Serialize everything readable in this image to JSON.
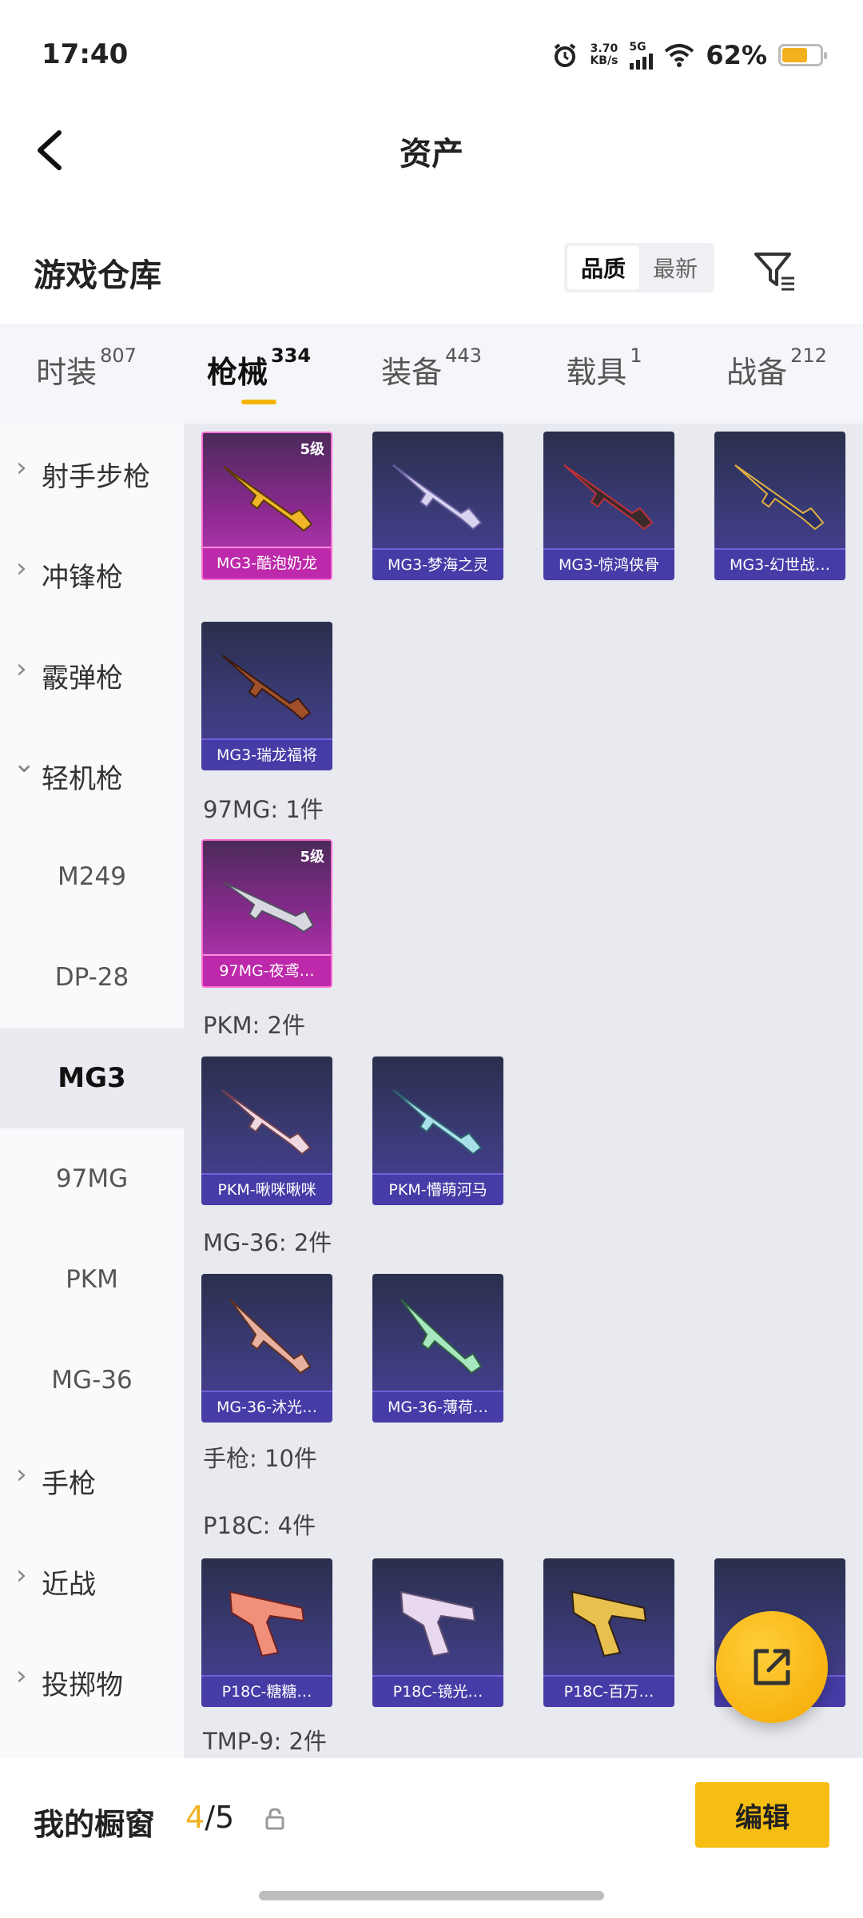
{
  "status": {
    "time": "17:40",
    "net_speed_value": "3.70",
    "net_speed_unit": "KB/s",
    "signal": "5G",
    "battery": "62%",
    "battery_level": 0.62
  },
  "header": {
    "title": "资产"
  },
  "warehouse": {
    "label": "游戏仓库",
    "sort_options": [
      "品质",
      "最新"
    ]
  },
  "tabs": [
    {
      "label": "时装",
      "count": "807"
    },
    {
      "label": "枪械",
      "count": "334"
    },
    {
      "label": "装备",
      "count": "443"
    },
    {
      "label": "载具",
      "count": "1"
    },
    {
      "label": "战备",
      "count": "212"
    }
  ],
  "sidebar": {
    "items": [
      {
        "label": "射手步枪"
      },
      {
        "label": "冲锋枪"
      },
      {
        "label": "霰弹枪"
      },
      {
        "label": "轻机枪"
      },
      {
        "label": "M249"
      },
      {
        "label": "DP-28"
      },
      {
        "label": "MG3"
      },
      {
        "label": "97MG"
      },
      {
        "label": "PKM"
      },
      {
        "label": "MG-36"
      },
      {
        "label": "手枪"
      },
      {
        "label": "近战"
      },
      {
        "label": "投掷物"
      }
    ]
  },
  "content": {
    "level_badge": "5级",
    "mg3": [
      "MG3-酷泡奶龙",
      "MG3-梦海之灵",
      "MG3-惊鸿侠骨",
      "MG3-幻世战…",
      "MG3-瑞龙福将"
    ],
    "sec_97mg": "97MG: 1件",
    "mg97": [
      "97MG-夜鸢…"
    ],
    "sec_pkm": "PKM: 2件",
    "pkm": [
      "PKM-啾咪啾咪",
      "PKM-懵萌河马"
    ],
    "sec_mg36": "MG-36: 2件",
    "mg36": [
      "MG-36-沐光…",
      "MG-36-薄荷…"
    ],
    "sec_pistol": "手枪: 10件",
    "sec_p18c": "P18C: 4件",
    "p18c": [
      "P18C-糖糖…",
      "P18C-镜光…",
      "P18C-百万…"
    ],
    "sec_tmp9": "TMP-9: 2件"
  },
  "bottom": {
    "label": "我的橱窗",
    "current": "4",
    "total": "/5",
    "edit": "编辑"
  }
}
